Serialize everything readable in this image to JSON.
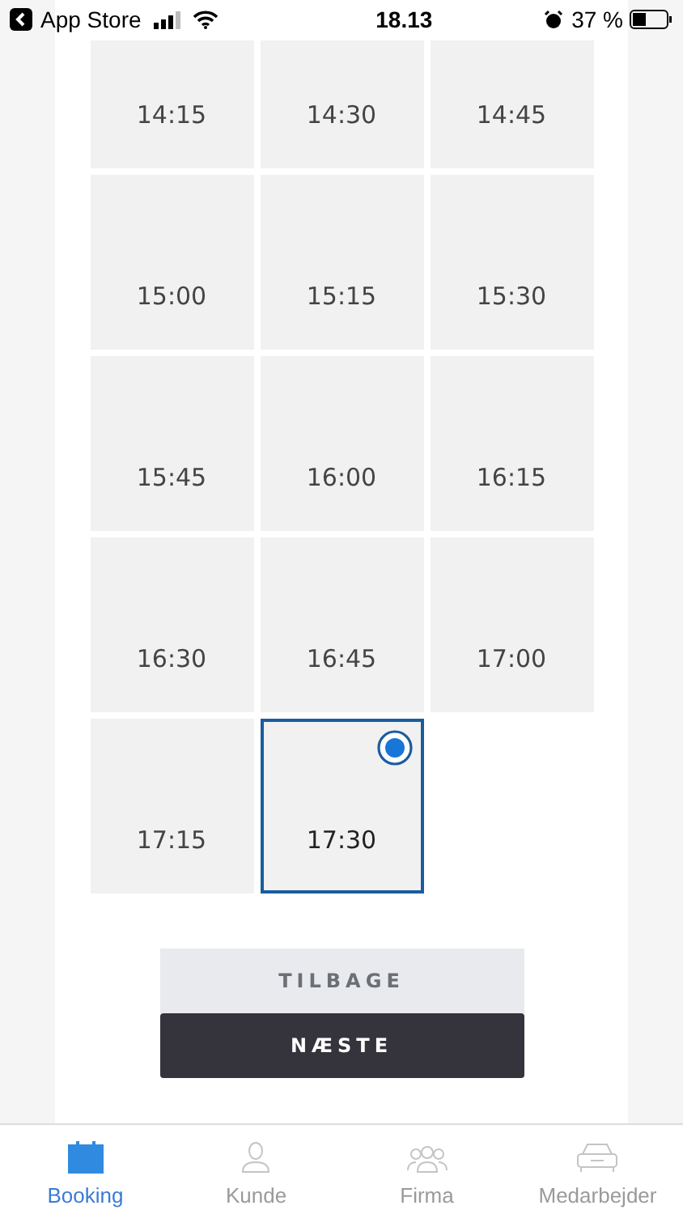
{
  "status_bar": {
    "back_label": "App Store",
    "time": "18.13",
    "battery": "37 %"
  },
  "slots": [
    {
      "time": "14:15",
      "selected": false
    },
    {
      "time": "14:30",
      "selected": false
    },
    {
      "time": "14:45",
      "selected": false
    },
    {
      "time": "15:00",
      "selected": false
    },
    {
      "time": "15:15",
      "selected": false
    },
    {
      "time": "15:30",
      "selected": false
    },
    {
      "time": "15:45",
      "selected": false
    },
    {
      "time": "16:00",
      "selected": false
    },
    {
      "time": "16:15",
      "selected": false
    },
    {
      "time": "16:30",
      "selected": false
    },
    {
      "time": "16:45",
      "selected": false
    },
    {
      "time": "17:00",
      "selected": false
    },
    {
      "time": "17:15",
      "selected": false
    },
    {
      "time": "17:30",
      "selected": true
    }
  ],
  "buttons": {
    "back": "TILBAGE",
    "next": "NÆSTE"
  },
  "tab_bar": [
    {
      "label": "Booking",
      "kind": "calendar",
      "selected": true
    },
    {
      "label": "Kunde",
      "kind": "person",
      "selected": false
    },
    {
      "label": "Firma",
      "kind": "group",
      "selected": false
    },
    {
      "label": "Medarbejder",
      "kind": "car",
      "selected": false
    }
  ]
}
